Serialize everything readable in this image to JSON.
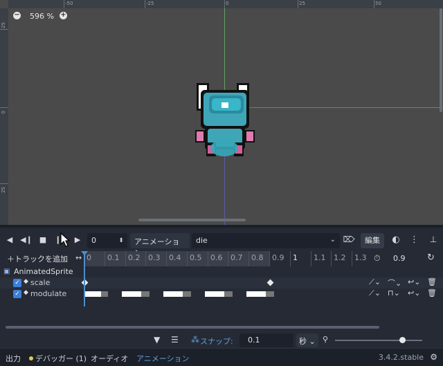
{
  "viewport": {
    "zoom_out": "−",
    "zoom_level": "596 %",
    "zoom_in": "+",
    "ruler_labels_x": [
      "-50",
      "-25",
      "0",
      "25",
      "50"
    ],
    "ruler_labels_y": [
      "-25",
      "0",
      "25"
    ]
  },
  "toolbar": {
    "frame_value": "0",
    "animation_label": "アニメーション",
    "animation_name": "die",
    "edit_label": "編集"
  },
  "timeline": {
    "add_track": "トラックを追加",
    "ticks": [
      "0",
      "0.1",
      "0.2",
      "0.3",
      "0.4",
      "0.5",
      "0.6",
      "0.7",
      "0.8",
      "0.9",
      "1",
      "1.1",
      "1.2",
      "1.3"
    ],
    "length": "0.9"
  },
  "tracks": {
    "root": "AnimatedSprite",
    "items": [
      {
        "label": "scale"
      },
      {
        "label": "modulate"
      }
    ]
  },
  "bottom": {
    "snap_label": "スナップ:",
    "snap_value": "0.1",
    "snap_unit": "秒"
  },
  "status": {
    "output": "出力",
    "debugger": "デバッガー (1)",
    "audio": "オーディオ",
    "animation": "アニメーション",
    "version": "3.4.2.stable"
  },
  "colors": {
    "accent": "#5fa0e0",
    "checkbox": "#3d7fd6",
    "debug_dot": "#e3c94f"
  }
}
